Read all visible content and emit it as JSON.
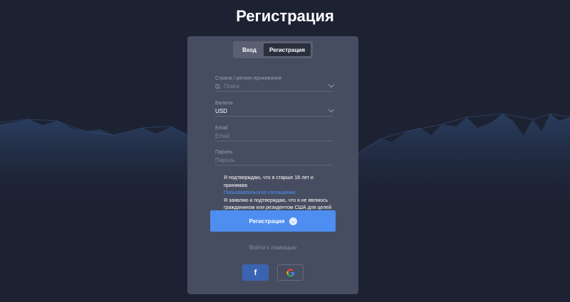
{
  "page": {
    "title": "Регистрация"
  },
  "tabs": [
    {
      "label": "Вход",
      "active": false
    },
    {
      "label": "Регистрация",
      "active": true
    }
  ],
  "form": {
    "country": {
      "label": "Страна / регион проживания",
      "placeholder": "Поиск"
    },
    "currency": {
      "label": "Валюта",
      "value": "USD"
    },
    "email": {
      "label": "Email",
      "placeholder": "Email"
    },
    "password": {
      "label": "Пароль",
      "placeholder": "Пароль"
    }
  },
  "consent": {
    "line1": "Я подтверждаю, что я старше 18 лет и принимаю",
    "link": "Пользовательское соглашение",
    "line2": "Я заявляю и подтверждаю, что я не являюсь гражданином или резидентом США для целей налогообложения."
  },
  "register_button": {
    "label": "Регистрация",
    "icon": "arrow-right-icon"
  },
  "social": {
    "label": "Войти с помощью",
    "facebook_icon": "f",
    "google_colors": [
      "#4285F4",
      "#34A853",
      "#FBBC05",
      "#EA4335"
    ]
  },
  "colors": {
    "background": "#1d2233",
    "card": "#474d60",
    "accent": "#4d8ef0",
    "link": "#4a93ff",
    "facebook": "#3b63b3"
  }
}
